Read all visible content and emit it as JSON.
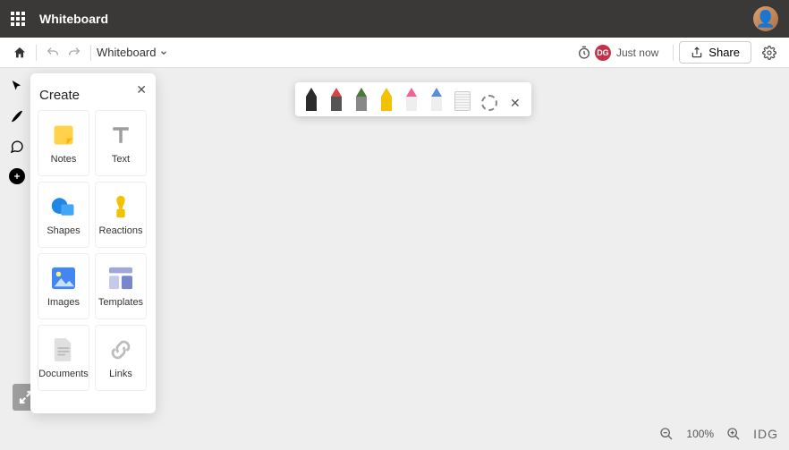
{
  "topbar": {
    "appName": "Whiteboard"
  },
  "commandBar": {
    "docTitle": "Whiteboard",
    "presence": {
      "initials": "DG",
      "status": "Just now"
    },
    "shareLabel": "Share"
  },
  "createPanel": {
    "title": "Create",
    "tiles": {
      "notes": "Notes",
      "text": "Text",
      "shapes": "Shapes",
      "reactions": "Reactions",
      "images": "Images",
      "templates": "Templates",
      "documents": "Documents",
      "links": "Links"
    }
  },
  "penToolbar": {
    "pens": [
      {
        "name": "black-pen",
        "color": "#2b2b2b"
      },
      {
        "name": "red-pen",
        "color": "#d64545"
      },
      {
        "name": "green-pen",
        "color": "#4a7a3a"
      },
      {
        "name": "yellow-pen",
        "color": "#f2c200"
      },
      {
        "name": "pink-highlighter",
        "color": "#f06292"
      },
      {
        "name": "blue-pen",
        "color": "#5b8ed6"
      }
    ]
  },
  "zoom": {
    "level": "100%"
  },
  "watermark": "IDG"
}
